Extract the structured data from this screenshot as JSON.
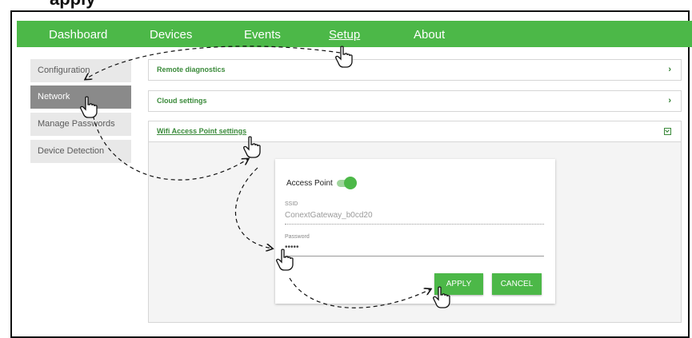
{
  "doc": {
    "title_fragment": "apply"
  },
  "nav": {
    "items": [
      {
        "label": "Dashboard"
      },
      {
        "label": "Devices"
      },
      {
        "label": "Events"
      },
      {
        "label": "Setup"
      },
      {
        "label": "About"
      }
    ],
    "active": "Setup"
  },
  "sidebar": {
    "items": [
      {
        "label": "Configuration"
      },
      {
        "label": "Network"
      },
      {
        "label": "Manage Passwords"
      },
      {
        "label": "Device Detection"
      }
    ],
    "active": "Network"
  },
  "sections": [
    {
      "label": "Remote diagnostics",
      "state": "collapsed",
      "icon": "chevron-right-icon"
    },
    {
      "label": "Cloud settings",
      "state": "collapsed",
      "icon": "chevron-right-icon"
    },
    {
      "label": "Wifi Access Point settings",
      "state": "expanded",
      "icon": "chevron-down-checkbox-icon"
    }
  ],
  "wifi_form": {
    "access_point_label": "Access Point",
    "access_point_on": true,
    "ssid_label": "SSID",
    "ssid_value": "ConextGateway_b0cd20",
    "password_label": "Password",
    "password_value": "•••••",
    "apply_label": "APPLY",
    "cancel_label": "CANCEL"
  },
  "colors": {
    "brand_green": "#4cb848",
    "sidebar_active": "#8a8a8a",
    "sidebar_bg": "#e8e8e8",
    "section_label": "#3a8a3a"
  }
}
